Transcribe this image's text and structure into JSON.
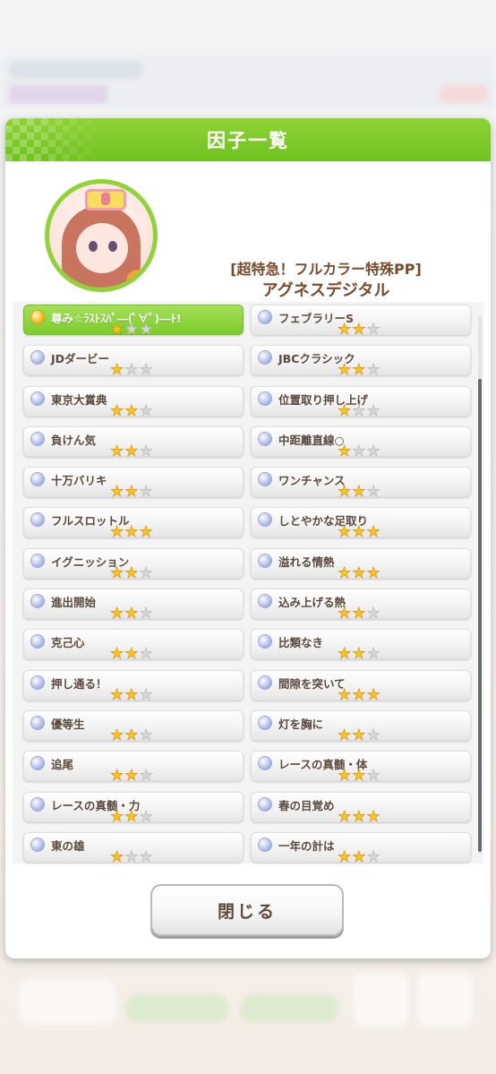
{
  "dialog": {
    "title": "因子一覧",
    "character": {
      "epithet": "[超特急！フルカラー特殊PP]",
      "name": "アグネスデジタル"
    },
    "close_label": "閉じる"
  },
  "factors": [
    {
      "label": "尊み☆ﾗｽﾄｽﾊﾟ―(ﾟ∀ﾟ)―ﾄ!",
      "stars": 1,
      "selected": true
    },
    {
      "label": "フェブラリーS",
      "stars": 2,
      "selected": false
    },
    {
      "label": "JDダービー",
      "stars": 1,
      "selected": false
    },
    {
      "label": "JBCクラシック",
      "stars": 2,
      "selected": false
    },
    {
      "label": "東京大賞典",
      "stars": 2,
      "selected": false
    },
    {
      "label": "位置取り押し上げ",
      "stars": 1,
      "selected": false
    },
    {
      "label": "負けん気",
      "stars": 2,
      "selected": false
    },
    {
      "label": "中距離直線○",
      "stars": 1,
      "selected": false
    },
    {
      "label": "十万バリキ",
      "stars": 2,
      "selected": false
    },
    {
      "label": "ワンチャンス",
      "stars": 2,
      "selected": false
    },
    {
      "label": "フルスロットル",
      "stars": 3,
      "selected": false
    },
    {
      "label": "しとやかな足取り",
      "stars": 3,
      "selected": false
    },
    {
      "label": "イグニッション",
      "stars": 2,
      "selected": false
    },
    {
      "label": "溢れる情熱",
      "stars": 3,
      "selected": false
    },
    {
      "label": "進出開始",
      "stars": 2,
      "selected": false
    },
    {
      "label": "込み上げる熱",
      "stars": 2,
      "selected": false
    },
    {
      "label": "克己心",
      "stars": 2,
      "selected": false
    },
    {
      "label": "比類なき",
      "stars": 2,
      "selected": false
    },
    {
      "label": "押し通る！",
      "stars": 2,
      "selected": false
    },
    {
      "label": "間隙を突いて",
      "stars": 3,
      "selected": false
    },
    {
      "label": "優等生",
      "stars": 2,
      "selected": false
    },
    {
      "label": "灯を胸に",
      "stars": 2,
      "selected": false
    },
    {
      "label": "追尾",
      "stars": 2,
      "selected": false
    },
    {
      "label": "レースの真髄・体",
      "stars": 2,
      "selected": false
    },
    {
      "label": "レースの真髄・力",
      "stars": 2,
      "selected": false
    },
    {
      "label": "春の目覚め",
      "stars": 3,
      "selected": false
    },
    {
      "label": "東の雄",
      "stars": 1,
      "selected": false
    },
    {
      "label": "一年の計は",
      "stars": 2,
      "selected": false
    }
  ],
  "colors": {
    "header_green": "#7cc925",
    "star_on": "#ffc515",
    "star_off": "#d6d6d6",
    "text_brown": "#5b4a3e"
  }
}
